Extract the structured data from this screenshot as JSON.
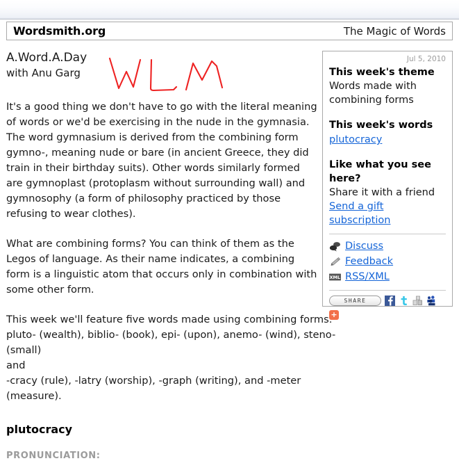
{
  "masthead": {
    "site_title": "Wordsmith.org",
    "tagline": "The Magic of Words"
  },
  "main": {
    "column_title": "A.Word.A.Day",
    "author_line": "with Anu Garg",
    "paragraph_1": "It's a good thing we don't have to go with the literal meaning of words or we'd be exercising in the nude in the gymnasia. The word gymnasium is derived from the combining form gymno-, meaning nude or bare (in ancient Greece, they did train in their birthday suits). Other words similarly formed are gymnoplast (protoplasm without surrounding wall) and gymnosophy (a form of philosophy practiced by those refusing to wear clothes).",
    "paragraph_2": "What are combining forms? You can think of them as the Legos of language. As their name indicates, a combining form is a linguistic atom that occurs only in combination with some other form.",
    "paragraph_3": "This week we'll feature five words made using combining forms: pluto- (wealth), biblio- (book), epi- (upon), anemo- (wind), steno- (small)\nand\n-cracy (rule), -latry (worship), -graph (writing), and -meter (measure).",
    "headword": "plutocracy",
    "pronunciation_label": "PRONUNCIATION:"
  },
  "annotation": {
    "ink_text": "WLM",
    "ink_color": "#ee2222"
  },
  "sidebar": {
    "date": "Jul 5, 2010",
    "theme_heading": "This week's theme",
    "theme_text": "Words made with combining forms",
    "words_heading": "This week's words",
    "word_link": "plutocracy",
    "promo_heading": "Like what you see here?",
    "promo_text": "Share it with a friend",
    "promo_link": "Send a gift subscription",
    "links": [
      {
        "label": "Discuss",
        "icon": "speech-bubbles-icon"
      },
      {
        "label": "Feedback",
        "icon": "pencil-icon"
      },
      {
        "label": "RSS/XML",
        "icon": "xml-badge-icon"
      }
    ],
    "share": {
      "button_label": "SHARE",
      "addthis_label": "+",
      "icons": [
        "facebook-icon",
        "twitter-icon",
        "delicious-icon",
        "myspace-icon"
      ]
    }
  },
  "colors": {
    "link_blue": "#1565d8",
    "muted_grey": "#9b9b9b",
    "border_grey": "#a9a9a9",
    "addthis_orange": "#f2704a",
    "facebook_blue": "#3b5998",
    "twitter_cyan": "#37c7e8",
    "myspace_blue": "#1b3f94"
  }
}
